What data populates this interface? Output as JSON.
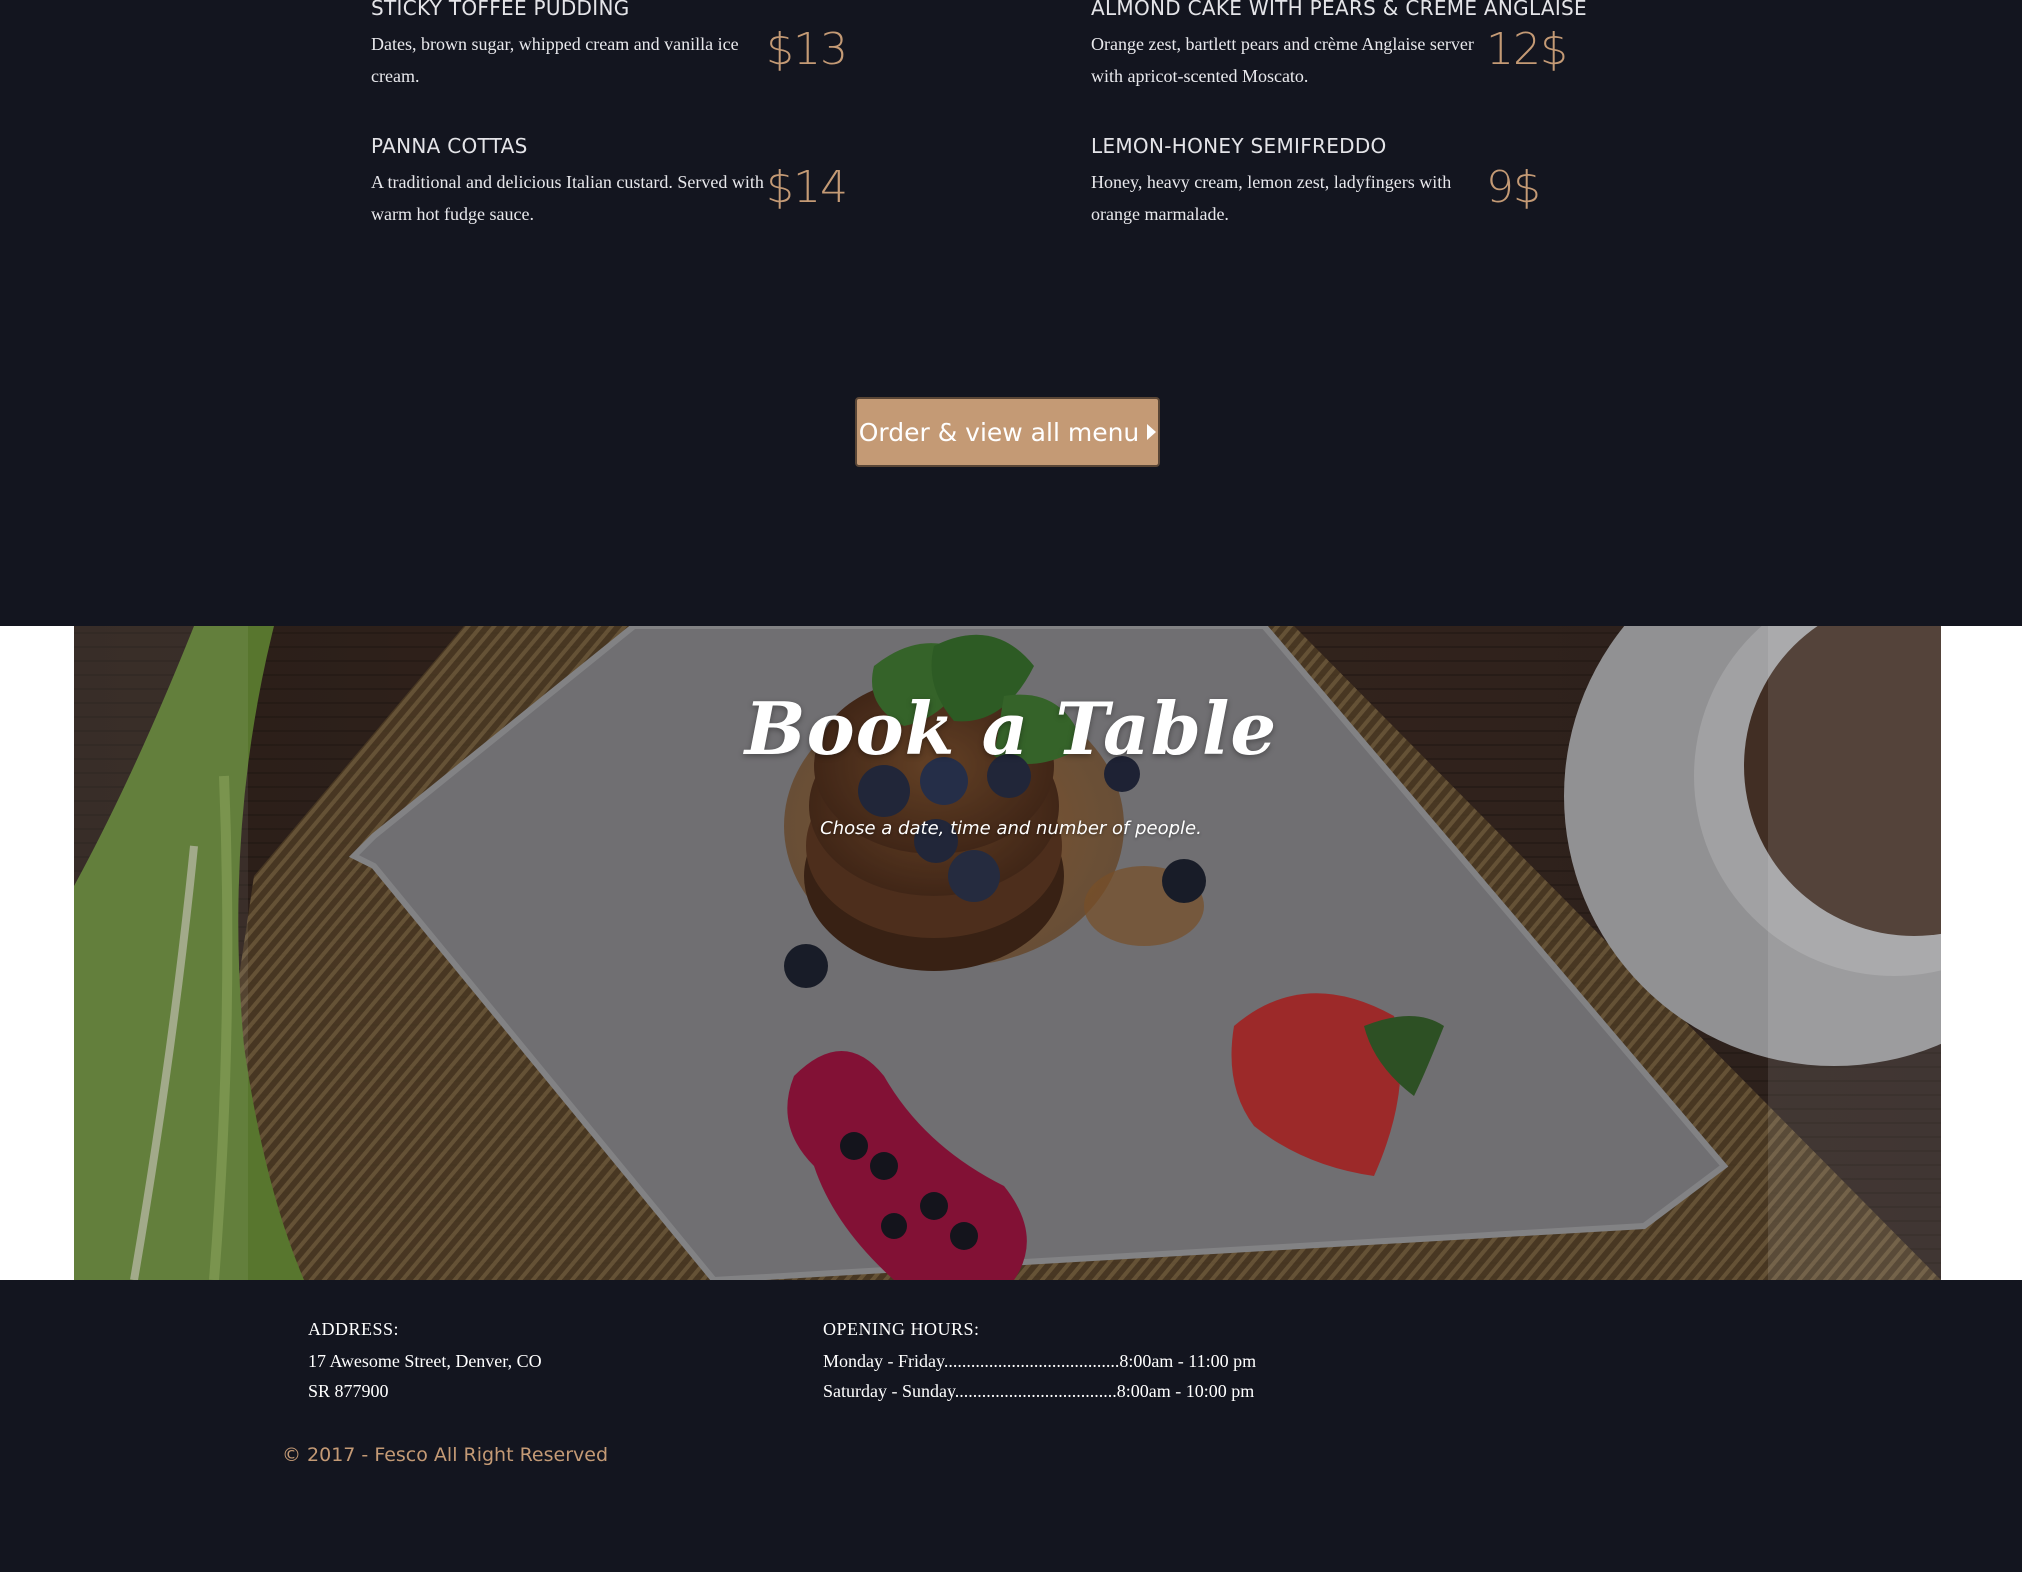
{
  "menu": {
    "items": [
      {
        "name": "STICKY TOFFEE PUDDING",
        "desc": "Dates, brown sugar, whipped cream and vanilla ice cream.",
        "price": "$13"
      },
      {
        "name": "ALMOND CAKE WITH PEARS & CREME ANGLAISE",
        "desc": "Orange zest, bartlett pears and crème Anglaise server with apricot-scented Moscato.",
        "price": "12$"
      },
      {
        "name": "PANNA COTTAS",
        "desc": "A traditional and delicious Italian custard. Served with warm hot fudge sauce.",
        "price": "$14"
      },
      {
        "name": "LEMON-HONEY SEMIFREDDO",
        "desc": "Honey, heavy cream, lemon zest, ladyfingers with orange marmalade.",
        "price": "9$"
      }
    ],
    "order_button": "Order & view all menu",
    "order_icon": "caret-right-icon"
  },
  "book": {
    "title": "Book a Table",
    "subtitle": "Chose a date, time and number of people."
  },
  "footer": {
    "address_head": "ADDRESS:",
    "address_line1": "17 Awesome Street, Denver, CO",
    "address_line2": "SR 877900",
    "hours_head": "OPENING HOURS:",
    "hours_line1": "Monday - Friday.......................................8:00am - 11:00 pm",
    "hours_line2": "Saturday - Sunday....................................8:00am - 10:00 pm",
    "copyright": "© 2017 - Fesco All Right Reserved"
  },
  "colors": {
    "background": "#13151f",
    "accent": "#c49a75"
  }
}
